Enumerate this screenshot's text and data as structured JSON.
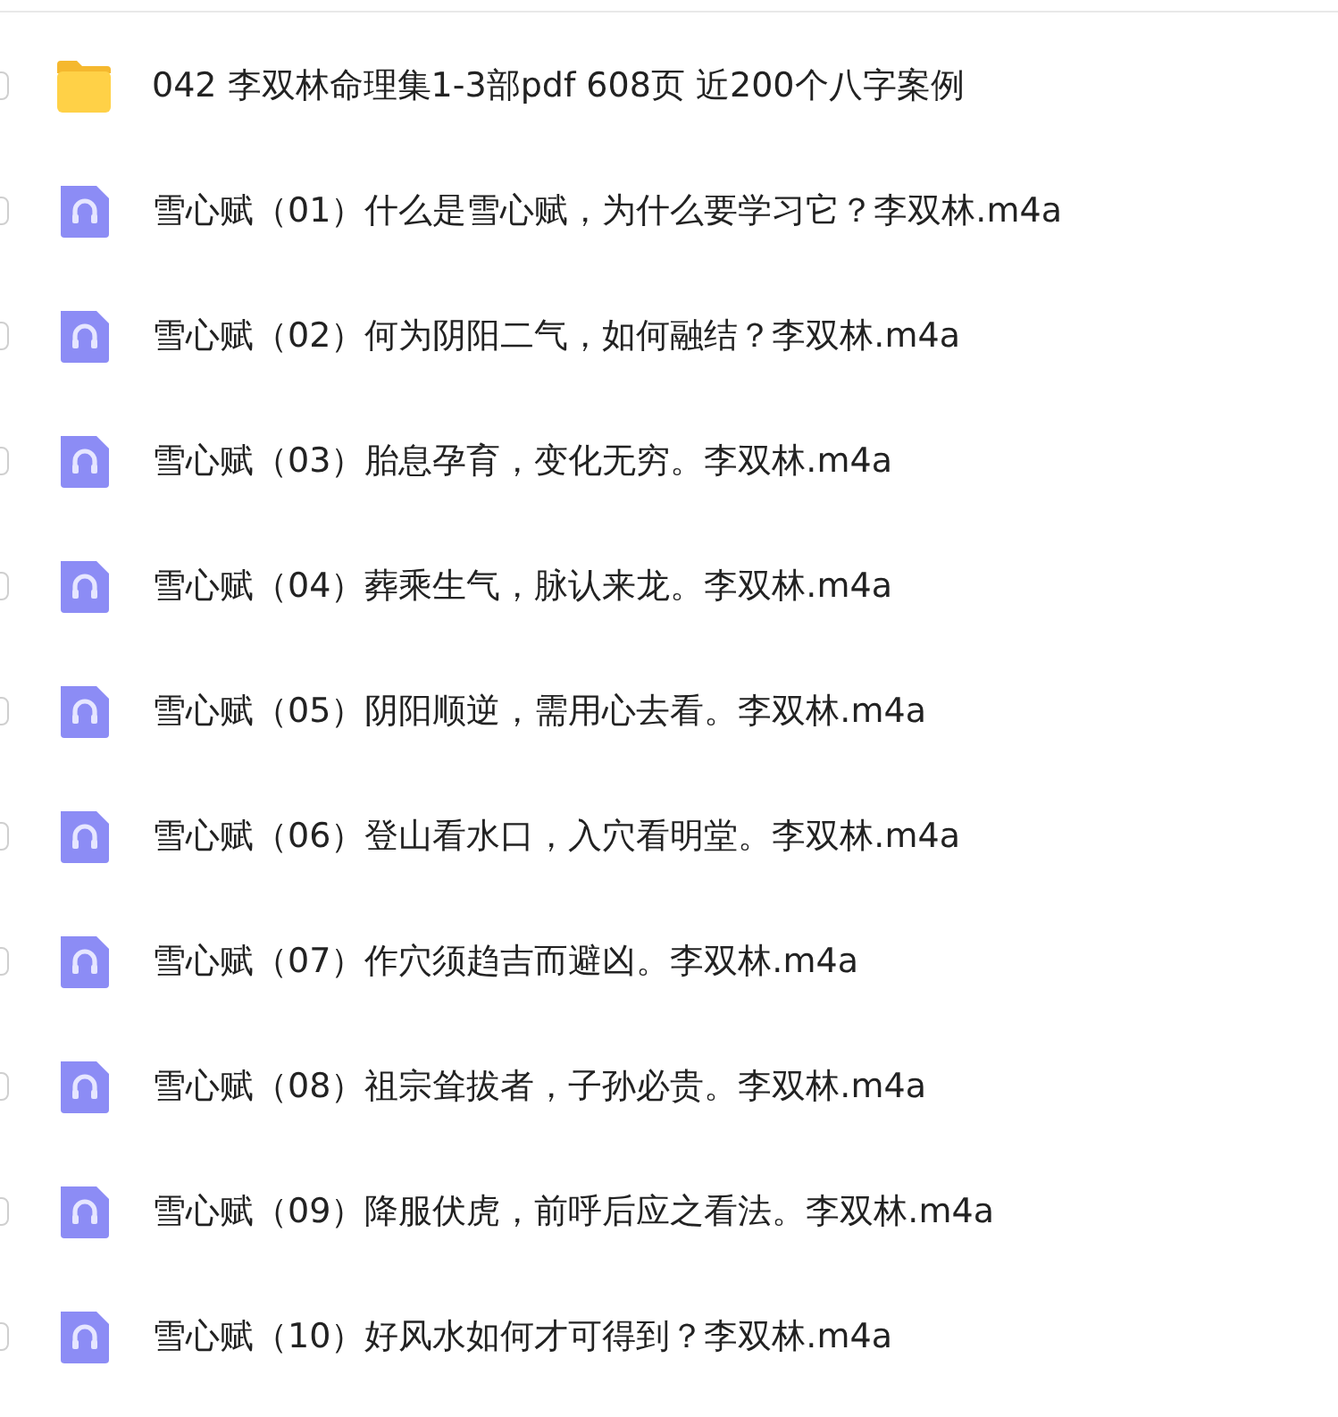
{
  "files": [
    {
      "kind": "folder",
      "name": "042 李双林命理集1-3部pdf 608页 近200个八字案例",
      "checked": false
    },
    {
      "kind": "audio",
      "name": "雪心赋（01）什么是雪心赋，为什么要学习它？李双林.m4a",
      "checked": false
    },
    {
      "kind": "audio",
      "name": "雪心赋（02）何为阴阳二气，如何融结？李双林.m4a",
      "checked": false
    },
    {
      "kind": "audio",
      "name": "雪心赋（03）胎息孕育，变化无穷。李双林.m4a",
      "checked": false
    },
    {
      "kind": "audio",
      "name": "雪心赋（04）葬乘生气，脉认来龙。李双林.m4a",
      "checked": false
    },
    {
      "kind": "audio",
      "name": "雪心赋（05）阴阳顺逆，需用心去看。李双林.m4a",
      "checked": false
    },
    {
      "kind": "audio",
      "name": "雪心赋（06）登山看水口，入穴看明堂。李双林.m4a",
      "checked": false
    },
    {
      "kind": "audio",
      "name": "雪心赋（07）作穴须趋吉而避凶。李双林.m4a",
      "checked": false
    },
    {
      "kind": "audio",
      "name": "雪心赋（08）祖宗耸拔者，子孙必贵。李双林.m4a",
      "checked": false
    },
    {
      "kind": "audio",
      "name": "雪心赋（09）降服伏虎，前呼后应之看法。李双林.m4a",
      "checked": false
    },
    {
      "kind": "audio",
      "name": "雪心赋（10）好风水如何才可得到？李双林.m4a",
      "checked": false
    }
  ]
}
